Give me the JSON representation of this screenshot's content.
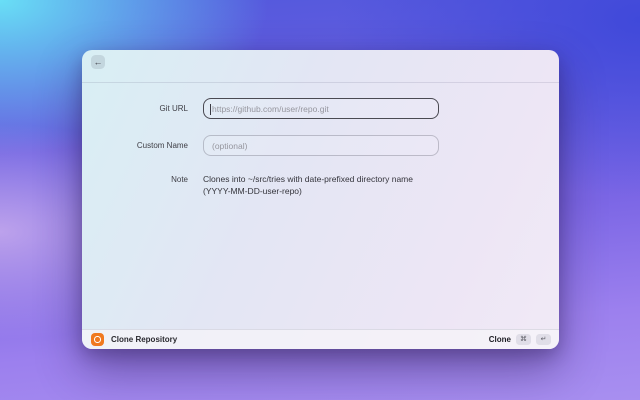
{
  "colors": {
    "accent_orange": "#F0791F",
    "bg_top_left_cyan": "#69DFF6",
    "bg_top_right_blue": "#4049DA",
    "bg_mid_lavender": "#C0A5EC",
    "bg_bottom_purple": "#9C80EE",
    "focused_input_border": "#4A4A52"
  },
  "window": {
    "header": {
      "back_icon": "←"
    },
    "form": {
      "git_url": {
        "label": "Git URL",
        "value": "",
        "placeholder": "https://github.com/user/repo.git"
      },
      "custom_name": {
        "label": "Custom Name",
        "value": "",
        "placeholder": "(optional)"
      },
      "note": {
        "label": "Note",
        "line1": "Clones into ~/src/tries with date-prefixed directory name",
        "line2": "(YYYY-MM-DD-user-repo)"
      }
    },
    "footer": {
      "extension_name": "Clone Repository",
      "primary_action_label": "Clone",
      "shortcut_keys": [
        "⌘",
        "↵"
      ]
    }
  }
}
